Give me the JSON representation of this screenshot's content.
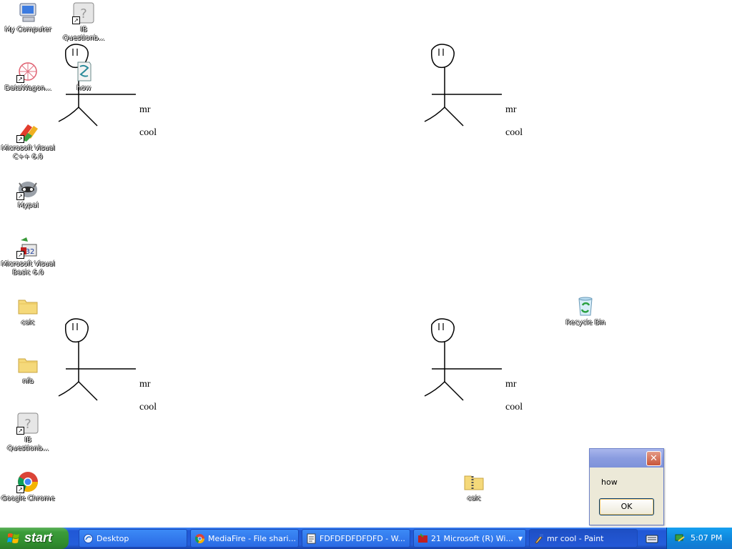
{
  "desktop": {
    "icons": [
      {
        "label": "My Computer",
        "name": "my-computer-icon"
      },
      {
        "label": "IB\nQuestionb...",
        "name": "ib-questionbank-shortcut-icon"
      },
      {
        "label": "DataWagon...",
        "name": "datawagon-icon"
      },
      {
        "label": "how",
        "name": "how-document-icon"
      },
      {
        "label": "Microsoft Visual\nC++ 6.0",
        "name": "visual-cpp-icon"
      },
      {
        "label": "Mypal",
        "name": "mypal-icon"
      },
      {
        "label": "Microsoft Visual\nBasic 6.0",
        "name": "visual-basic-icon"
      },
      {
        "label": "calc",
        "name": "calc-folder-icon"
      },
      {
        "label": "nfb",
        "name": "nfb-folder-icon"
      },
      {
        "label": "IB\nQuestionb...",
        "name": "ib-questionbank-shortcut-2-icon"
      },
      {
        "label": "Google Chrome",
        "name": "google-chrome-icon"
      },
      {
        "label": "Recycle Bin",
        "name": "recycle-bin-icon"
      },
      {
        "label": "calc",
        "name": "calc-zip-icon"
      }
    ],
    "figures": [
      {
        "line1": "mr",
        "line2": "cool"
      },
      {
        "line1": "mr",
        "line2": "cool"
      },
      {
        "line1": "mr",
        "line2": "cool"
      },
      {
        "line1": "mr",
        "line2": "cool"
      }
    ]
  },
  "dialog": {
    "message": "how",
    "ok_label": "OK",
    "close_glyph": "✕"
  },
  "taskbar": {
    "start_label": "start",
    "buttons": [
      {
        "label": "Desktop"
      },
      {
        "label": "MediaFire - File shari..."
      },
      {
        "label": "FDFDFDFDFDFD - W..."
      },
      {
        "label": "21 Microsoft (R) Wi..."
      },
      {
        "label": "mr cool - Paint"
      }
    ],
    "clock": "5:07 PM"
  }
}
